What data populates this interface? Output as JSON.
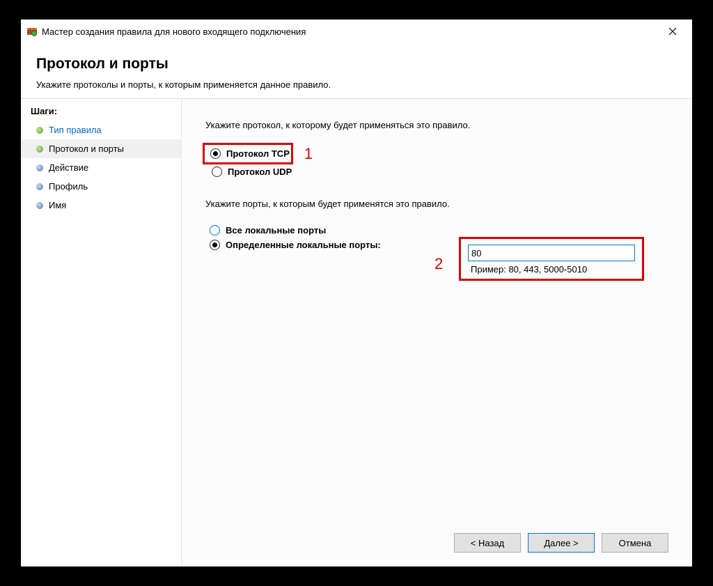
{
  "window": {
    "title": "Мастер создания правила для нового входящего подключения"
  },
  "header": {
    "title": "Протокол и порты",
    "subtitle": "Укажите протоколы и порты, к которым применяется данное правило."
  },
  "sidebar": {
    "header": "Шаги:",
    "steps": [
      {
        "label": "Тип правила"
      },
      {
        "label": "Протокол и порты"
      },
      {
        "label": "Действие"
      },
      {
        "label": "Профиль"
      },
      {
        "label": "Имя"
      }
    ]
  },
  "content": {
    "protocol_prompt": "Укажите протокол, к которому будет применяться это правило.",
    "tcp_label": "Протокол TCP",
    "udp_label": "Протокол UDP",
    "ports_prompt": "Укажите порты, к которым будет применятся это правило.",
    "all_ports_label": "Все локальные порты",
    "specific_ports_label": "Определенные локальные порты:",
    "port_value": "80",
    "port_example": "Пример: 80, 443, 5000-5010"
  },
  "annotations": {
    "one": "1",
    "two": "2"
  },
  "footer": {
    "back": "< Назад",
    "next": "Далее >",
    "cancel": "Отмена"
  }
}
